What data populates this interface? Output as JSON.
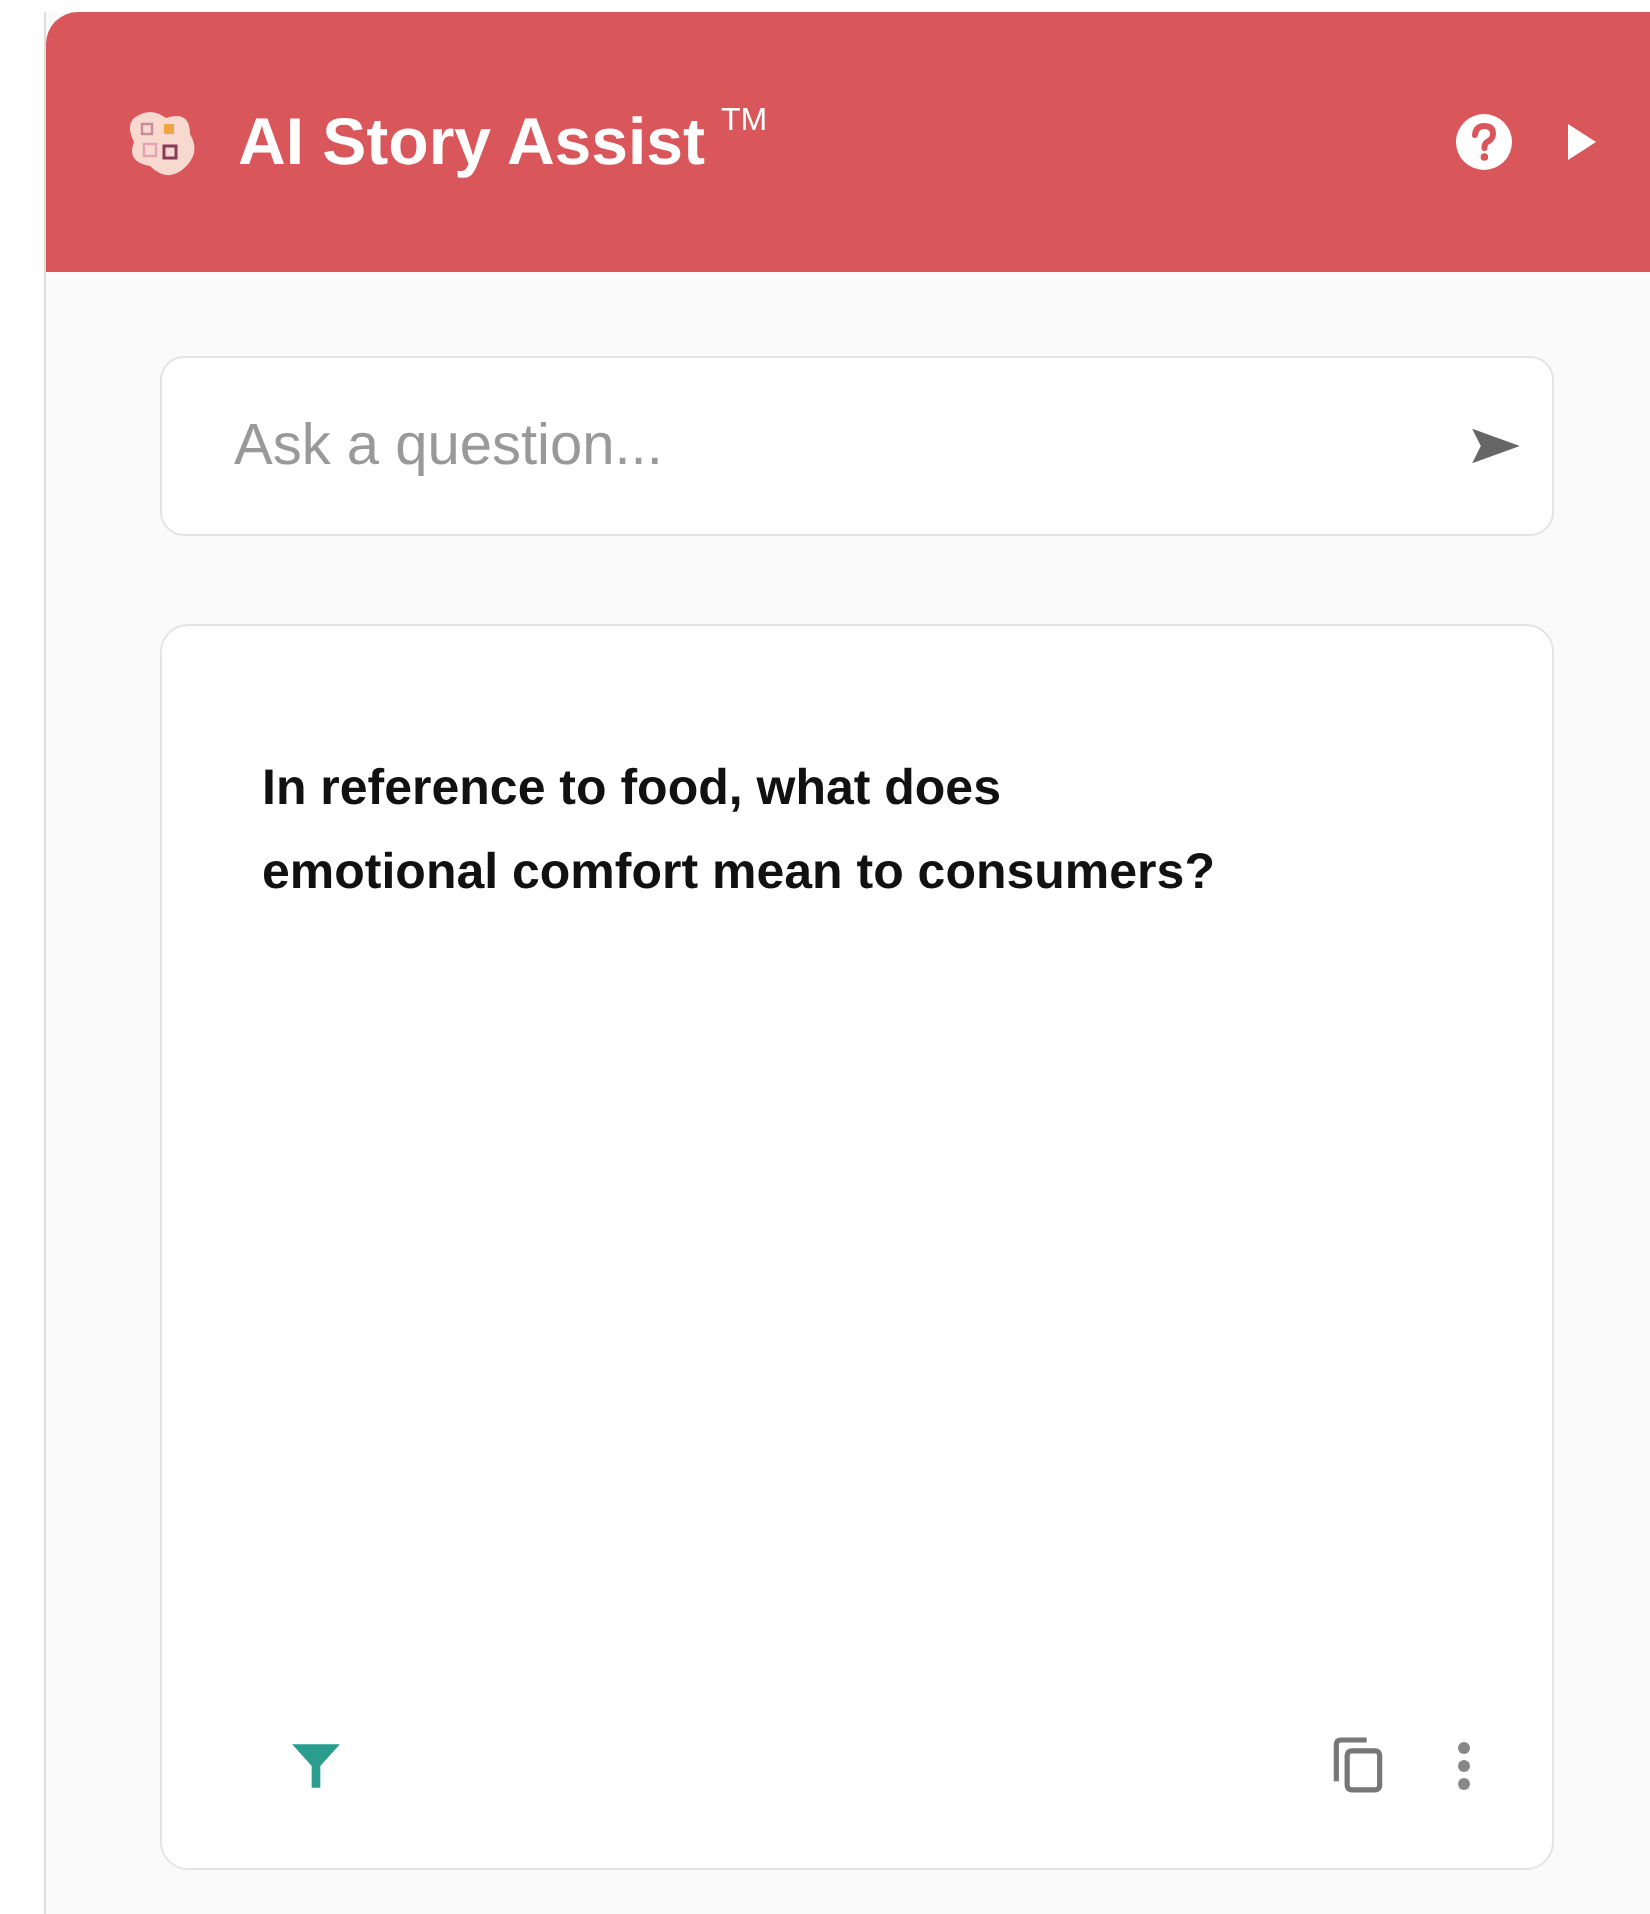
{
  "header": {
    "title": "AI Story Assist",
    "trademark": "TM"
  },
  "search": {
    "placeholder": "Ask a question..."
  },
  "card": {
    "question": "In reference to food, what does emotional comfort mean to consumers?"
  }
}
